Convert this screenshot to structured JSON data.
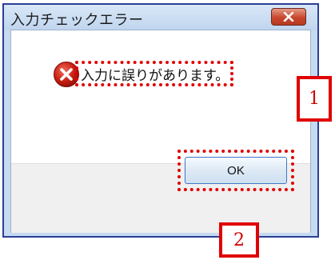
{
  "dialog": {
    "title": "入力チェックエラー",
    "message": "入力に誤りがあります。",
    "ok_label": "OK"
  },
  "icons": {
    "close": "close-icon",
    "error": "error-icon"
  },
  "annotations": [
    {
      "label": "1"
    },
    {
      "label": "2"
    }
  ],
  "colors": {
    "highlight": "#e00000",
    "window_frame": "#2b3f97",
    "close_button": "#c8472d"
  }
}
